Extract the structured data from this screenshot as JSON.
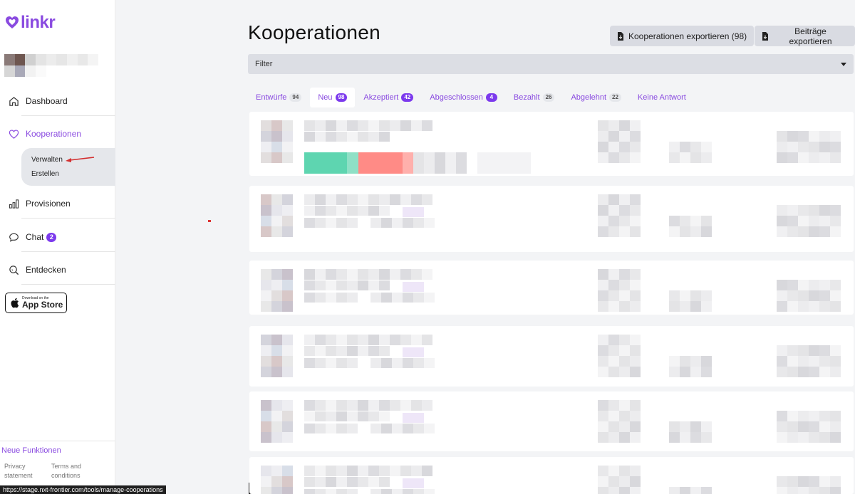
{
  "brand": {
    "name": "linkr"
  },
  "sidebar": {
    "items": [
      {
        "label": "Dashboard",
        "icon": "home-icon"
      },
      {
        "label": "Kooperationen",
        "icon": "heart-icon"
      },
      {
        "label": "Provisionen",
        "icon": "bar-chart-icon"
      },
      {
        "label": "Chat",
        "icon": "chat-icon",
        "badge": "2"
      },
      {
        "label": "Entdecken",
        "icon": "search-icon"
      }
    ],
    "sub_items": [
      {
        "label": "Verwalten"
      },
      {
        "label": "Erstellen"
      }
    ],
    "appstore": {
      "small": "Download on the",
      "big": "App Store"
    },
    "neue": "Neue Funktionen",
    "privacy": "Privacy statement",
    "terms": "Terms and conditions"
  },
  "statusbar": {
    "url": "https://stage.nxt-frontier.com/tools/manage-cooperations"
  },
  "main": {
    "title": "Kooperationen",
    "export_coops": "Kooperationen exportieren (98)",
    "export_posts": "Beiträge exportieren",
    "filter_label": "Filter",
    "tabs": [
      {
        "label": "Entwürfe",
        "count": "94"
      },
      {
        "label": "Neu",
        "count": "98"
      },
      {
        "label": "Akzeptiert",
        "count": "42"
      },
      {
        "label": "Abgeschlossen",
        "count": "4"
      },
      {
        "label": "Bezahlt",
        "count": "26"
      },
      {
        "label": "Abgelehnt",
        "count": "22"
      },
      {
        "label": "Keine Antwort",
        "count": ""
      }
    ]
  },
  "colors": {
    "accent": "#8a4be0",
    "badge": "#7c3aed",
    "progress_green": "#5ed5b0",
    "progress_red": "#ff8b86"
  }
}
